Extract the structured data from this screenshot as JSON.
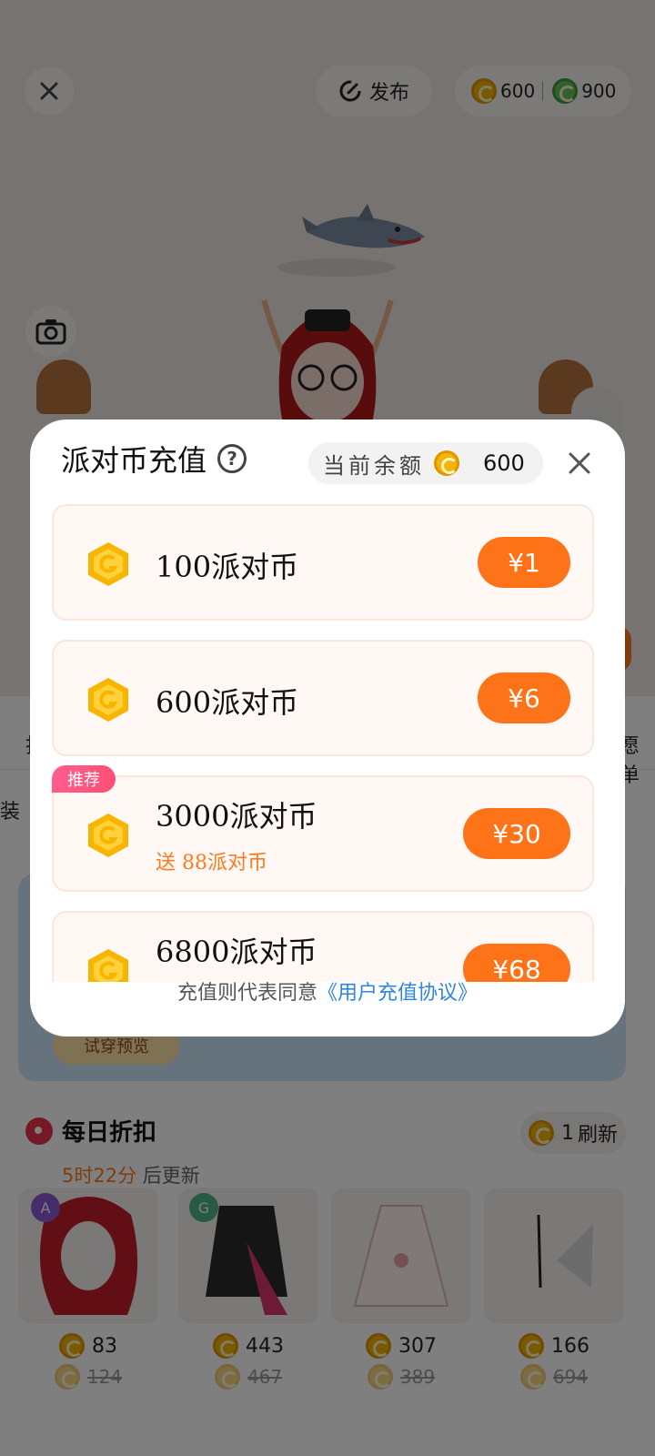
{
  "topbar": {
    "publish_label": "发布",
    "gold_balance": "600",
    "green_balance": "900"
  },
  "background": {
    "left_tab_partial": "找",
    "right_tab_partial": "愿单",
    "left_tab2_partial": "装",
    "try_on_label": "试穿预览"
  },
  "daily": {
    "title": "每日折扣",
    "refresh_count": "1",
    "refresh_label": "刷新",
    "countdown": "5时22分",
    "countdown_suffix": "后更新",
    "items": [
      {
        "badge": "A",
        "price": "83",
        "old_price": "124"
      },
      {
        "badge": "G",
        "price": "443",
        "old_price": "467"
      },
      {
        "badge": "",
        "price": "307",
        "old_price": "389"
      },
      {
        "badge": "",
        "price": "166",
        "old_price": "694"
      }
    ]
  },
  "modal": {
    "title": "派对币充值",
    "balance_label": "当前余额",
    "balance_value": "600",
    "packages": [
      {
        "name": "100派对币",
        "bonus": "",
        "price": "¥1",
        "tag": ""
      },
      {
        "name": "600派对币",
        "bonus": "",
        "price": "¥6",
        "tag": ""
      },
      {
        "name": "3000派对币",
        "bonus": "送 88派对币",
        "price": "¥30",
        "tag": "推荐"
      },
      {
        "name": "6800派对币",
        "bonus": "",
        "price": "¥68",
        "tag": ""
      }
    ],
    "agreement_text": "充值则代表同意",
    "agreement_link": "《用户充值协议》"
  },
  "colors": {
    "accent": "#ff7318",
    "link": "#2e84e4",
    "coin_gold": "#f5b400"
  }
}
